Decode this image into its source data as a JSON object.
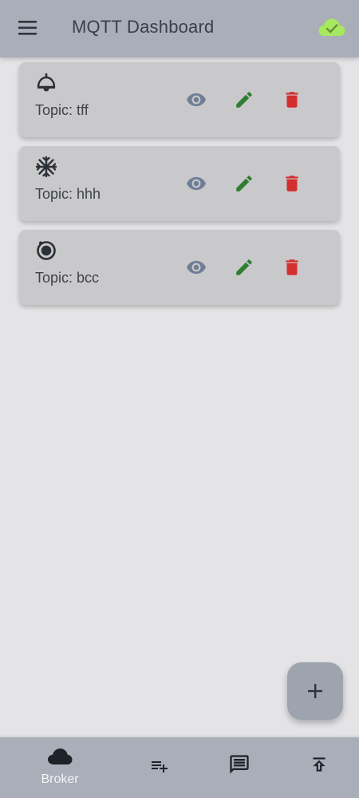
{
  "appbar": {
    "title": "MQTT Dashboard",
    "menu_icon": "menu-icon",
    "status_icon": "cloud-connected-icon"
  },
  "cards": [
    {
      "icon": "ceiling-lamp-icon",
      "topic": "Topic: tff"
    },
    {
      "icon": "snowflake-icon",
      "topic": "Topic: hhh"
    },
    {
      "icon": "radio-button-icon",
      "topic": "Topic: bcc"
    }
  ],
  "card_actions": {
    "view_icon": "eye-icon",
    "edit_icon": "pencil-icon",
    "delete_icon": "trash-icon"
  },
  "fab": {
    "icon": "plus-icon"
  },
  "bottom_nav": {
    "items": [
      {
        "label": "Broker",
        "icon": "cloud-icon"
      },
      {
        "icon": "playlist-add-icon"
      },
      {
        "icon": "message-icon"
      },
      {
        "icon": "publish-icon"
      }
    ]
  },
  "colors": {
    "appbar": "#a9aeb8",
    "background": "#e4e4e6",
    "card": "#c9c8ca",
    "connected": "#a6e95f",
    "view": "#6f7e96",
    "edit": "#2e7d32",
    "delete": "#d32f2f",
    "fab": "#9da4ae"
  }
}
